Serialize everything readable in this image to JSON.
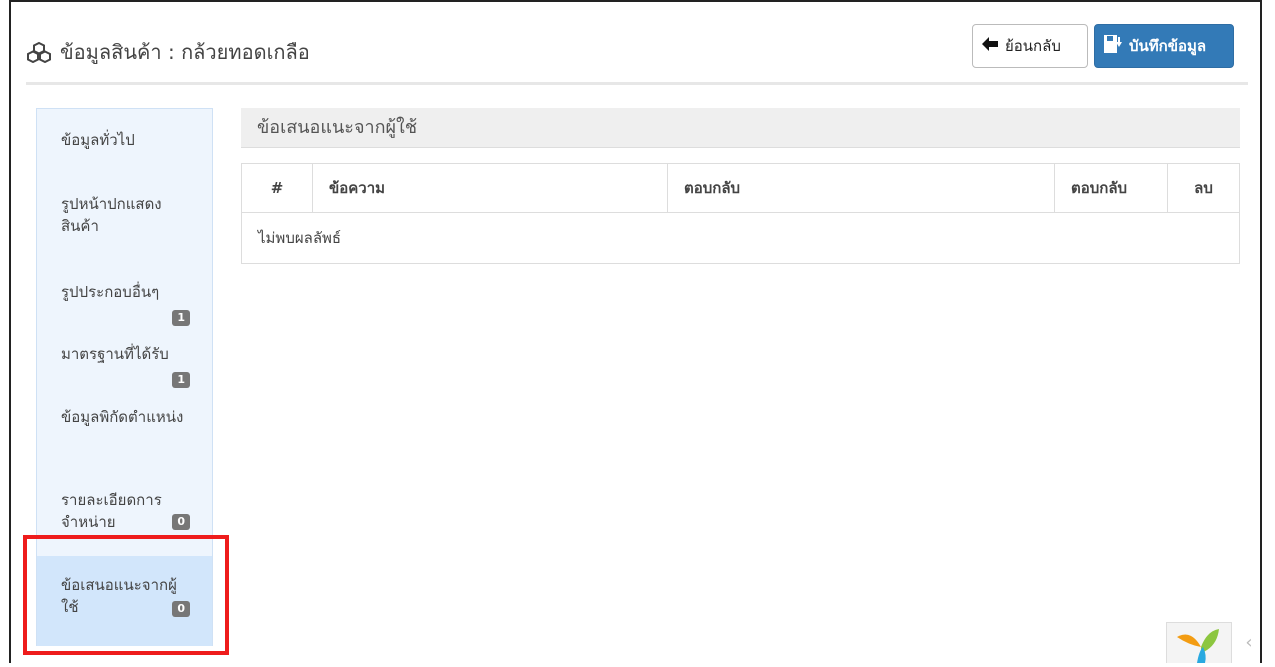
{
  "header": {
    "title": "ข้อมูลสินค้า : กล้วยทอดเกลือ",
    "title_icon": "cubes-icon",
    "back_label": "ย้อนกลับ",
    "back_icon": "arrow-left-icon",
    "save_label": "บันทึกข้อมูล",
    "save_icon": "save-icon"
  },
  "sidebar": {
    "items": [
      {
        "label": "ข้อมูลทั่วไป",
        "badge": null
      },
      {
        "label": "รูปหน้าปกแสดงสินค้า",
        "badge": null
      },
      {
        "label": "รูปประกอบอื่นๆ",
        "badge": "1"
      },
      {
        "label": "มาตรฐานที่ได้รับ",
        "badge": "1"
      },
      {
        "label": "ข้อมูลพิกัดตำแหน่ง",
        "badge": null
      },
      {
        "label": "รายละเอียดการจำหน่าย",
        "badge": "0"
      },
      {
        "label": "ข้อเสนอแนะจากผู้ใช้",
        "badge": "0",
        "active": true
      }
    ]
  },
  "main": {
    "section_title": "ข้อเสนอแนะจากผู้ใช้",
    "table": {
      "columns": [
        "#",
        "ข้อความ",
        "ตอบกลับ",
        "ตอบกลับ",
        "ลบ"
      ],
      "empty_message": "ไม่พบผลลัพธ์"
    }
  },
  "colors": {
    "primary": "#337ab7",
    "sidebar_bg": "#eef5fd",
    "sidebar_active": "#d2e6fb",
    "highlight": "#ee1c1c",
    "badge": "#777777"
  }
}
